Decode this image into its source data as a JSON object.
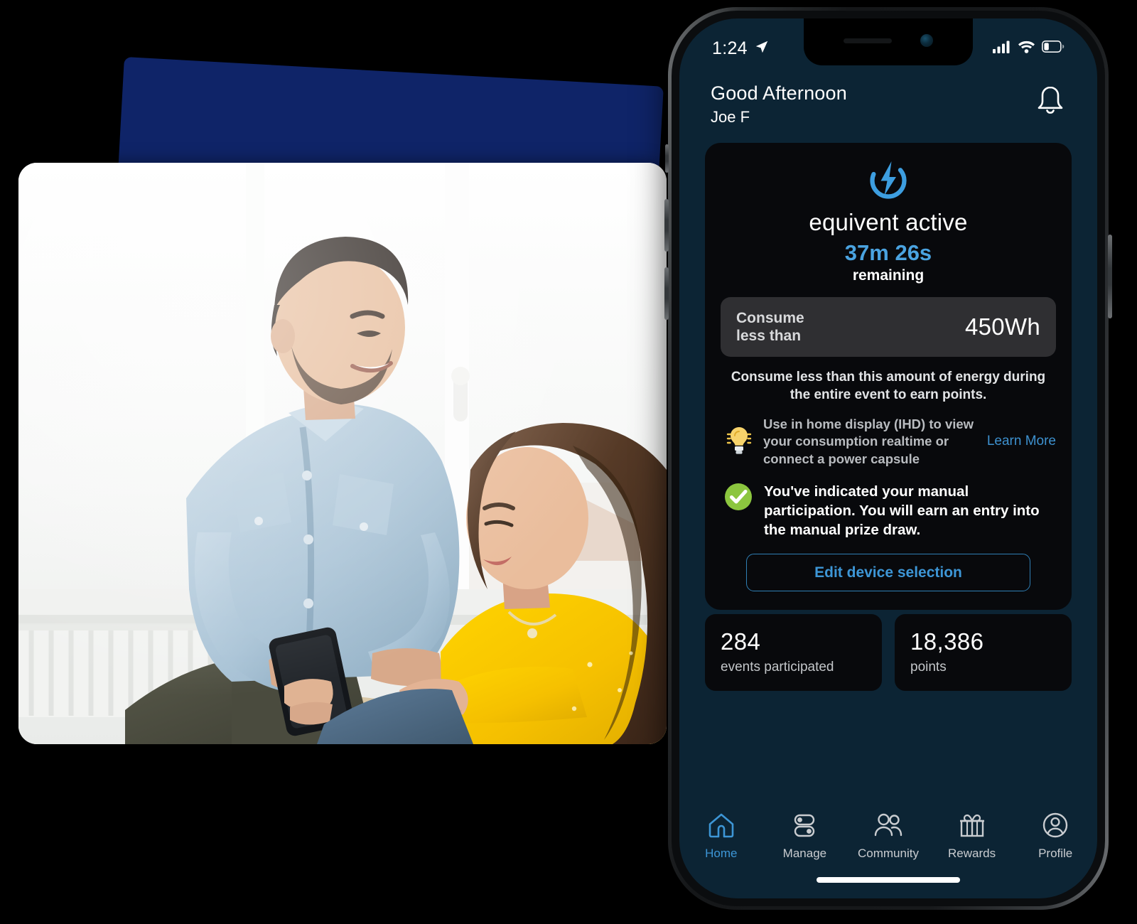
{
  "phone": {
    "status_bar": {
      "time": "1:24",
      "location_icon": "location-arrow-icon",
      "cellular_icon": "cellular-bars-icon",
      "wifi_icon": "wifi-icon",
      "battery_icon": "battery-low-icon"
    },
    "header": {
      "greeting": "Good Afternoon",
      "user_name": "Joe F",
      "notification_icon": "bell-icon"
    },
    "event_card": {
      "logo_icon": "power-bolt-icon",
      "title": "equivent active",
      "timer": "37m 26s",
      "timer_caption": "remaining",
      "consume_label_line1": "Consume",
      "consume_label_line2": "less than",
      "consume_value": "450Wh",
      "description": "Consume less than this amount of energy during the entire event to earn points.",
      "ihd_icon": "lightbulb-icon",
      "ihd_text": "Use in home display (IHD) to view your consumption realtime or connect a power capsule",
      "learn_more_label": "Learn More",
      "confirm_icon": "check-circle-icon",
      "confirm_text": "You've indicated your manual participation. You will earn an entry into the manual prize draw.",
      "edit_button_label": "Edit device selection"
    },
    "stats": [
      {
        "value": "284",
        "label": "events participated"
      },
      {
        "value": "18,386",
        "label": "points"
      }
    ],
    "tabs": [
      {
        "label": "Home",
        "icon": "home-icon",
        "active": true
      },
      {
        "label": "Manage",
        "icon": "toggles-icon",
        "active": false
      },
      {
        "label": "Community",
        "icon": "people-icon",
        "active": false
      },
      {
        "label": "Rewards",
        "icon": "gift-icon",
        "active": false
      },
      {
        "label": "Profile",
        "icon": "user-circle-icon",
        "active": false
      }
    ]
  },
  "photo": {
    "alt": "Smiling man in light blue denim shirt showing a smartphone to a woman in a yellow sweater, sitting by a bright window"
  },
  "colors": {
    "accent_blue": "#3d96d6",
    "timer_blue": "#4aa3e0",
    "navy_shape": "#0f2468",
    "app_background": "#0c2434",
    "card_background": "#08090c",
    "consume_row": "#2f2f32",
    "check_green": "#8cc63f",
    "bulb_yellow": "#f7d36b"
  }
}
